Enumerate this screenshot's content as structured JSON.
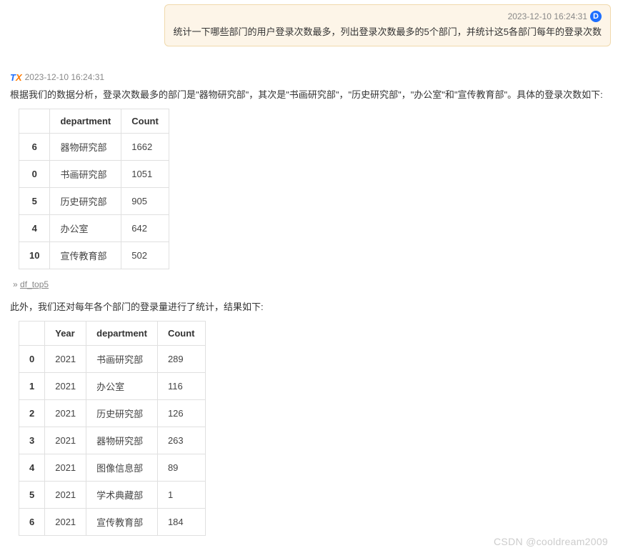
{
  "user_message": {
    "timestamp": "2023-12-10 16:24:31",
    "avatar_letter": "D",
    "text": "统计一下哪些部门的用户登录次数最多，列出登录次数最多的5个部门，并统计这5各部门每年的登录次数"
  },
  "assistant": {
    "timestamp": "2023-12-10 16:24:31",
    "intro_text": "根据我们的数据分析，登录次数最多的部门是\"器物研究部\"，其次是\"书画研究部\"，\"历史研究部\"，\"办公室\"和\"宣传教育部\"。具体的登录次数如下:",
    "table1": {
      "headers": [
        "",
        "department",
        "Count"
      ],
      "rows": [
        [
          "6",
          "器物研究部",
          "1662"
        ],
        [
          "0",
          "书画研究部",
          "1051"
        ],
        [
          "5",
          "历史研究部",
          "905"
        ],
        [
          "4",
          "办公室",
          "642"
        ],
        [
          "10",
          "宣传教育部",
          "502"
        ]
      ]
    },
    "ref_prefix": "» ",
    "ref_label": "df_top5",
    "mid_text": "此外，我们还对每年各个部门的登录量进行了统计，结果如下:",
    "table2": {
      "headers": [
        "",
        "Year",
        "department",
        "Count"
      ],
      "rows": [
        [
          "0",
          "2021",
          "书画研究部",
          "289"
        ],
        [
          "1",
          "2021",
          "办公室",
          "116"
        ],
        [
          "2",
          "2021",
          "历史研究部",
          "126"
        ],
        [
          "3",
          "2021",
          "器物研究部",
          "263"
        ],
        [
          "4",
          "2021",
          "图像信息部",
          "89"
        ],
        [
          "5",
          "2021",
          "学术典藏部",
          "1"
        ],
        [
          "6",
          "2021",
          "宣传教育部",
          "184"
        ]
      ]
    }
  },
  "watermark": "CSDN @cooldream2009"
}
